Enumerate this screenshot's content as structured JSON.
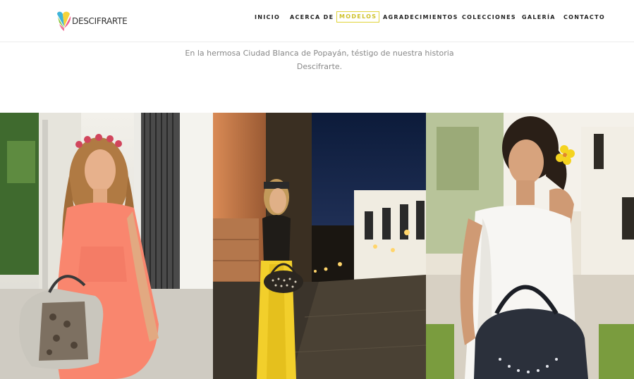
{
  "brand": {
    "logo_text": "DESCIFRARTE",
    "colors": [
      "#f05a8a",
      "#f6d33a",
      "#3fb4d9",
      "#8cc63f"
    ]
  },
  "nav": {
    "items": [
      {
        "label": "INICIO",
        "active": false
      },
      {
        "label": "ACERCA DE",
        "active": false
      },
      {
        "label": "MODELOS",
        "active": true
      },
      {
        "label": "AGRADECIMIENTOS",
        "active": false
      },
      {
        "label": "COLECCIONES",
        "active": false
      },
      {
        "label": "GALERÍA",
        "active": false
      },
      {
        "label": "CONTACTO",
        "active": false
      }
    ],
    "active_color": "#e1d43a"
  },
  "intro": {
    "line1": "En la hermosa Ciudad Blanca de Popayán, téstigo de nuestra historia",
    "line2": "Descifrarte."
  },
  "gallery": {
    "photos": [
      {
        "name": "model-pink-dress",
        "subject": "Model in coral dress with snakeskin handbag"
      },
      {
        "name": "model-yellow-skirt",
        "subject": "Model in yellow skirt with studded handbag at night"
      },
      {
        "name": "model-white-dress",
        "subject": "Model in white dress with black handbag"
      }
    ]
  }
}
